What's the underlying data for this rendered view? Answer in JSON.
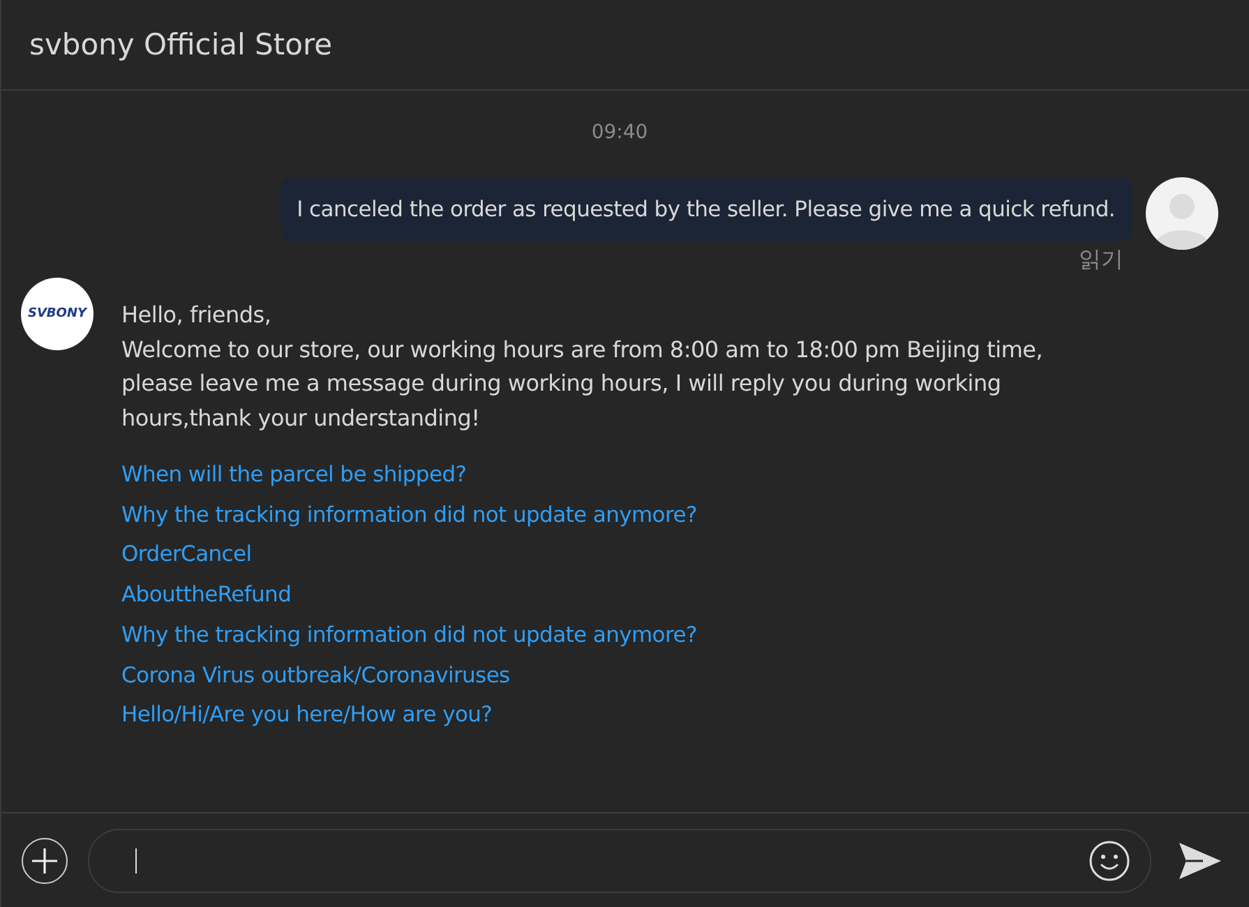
{
  "window": {
    "title": "svbony Official Store"
  },
  "messages": [
    {
      "kind": "time",
      "text": "09:40"
    },
    {
      "kind": "outgoing",
      "text": "I canceled the order as requested by the seller. Please give me a quick refund.",
      "receipt": "읽기"
    },
    {
      "kind": "incoming",
      "logo": "SVBONY",
      "lines": [
        "Hello, friends,",
        "Welcome to our store, our working hours are from 8:00 am to 18:00 pm Beijing time, please leave me a message during working hours, I will reply you during working hours,thank your understanding!"
      ],
      "links": [
        "When will the parcel be shipped?",
        "Why the tracking information did not update anymore?",
        "OrderCancel",
        "AbouttheRefund",
        "Why the tracking information did not update anymore?",
        "Corona Virus outbreak/Coronaviruses",
        "Hello/Hi/Are you here/How are you?"
      ]
    }
  ]
}
